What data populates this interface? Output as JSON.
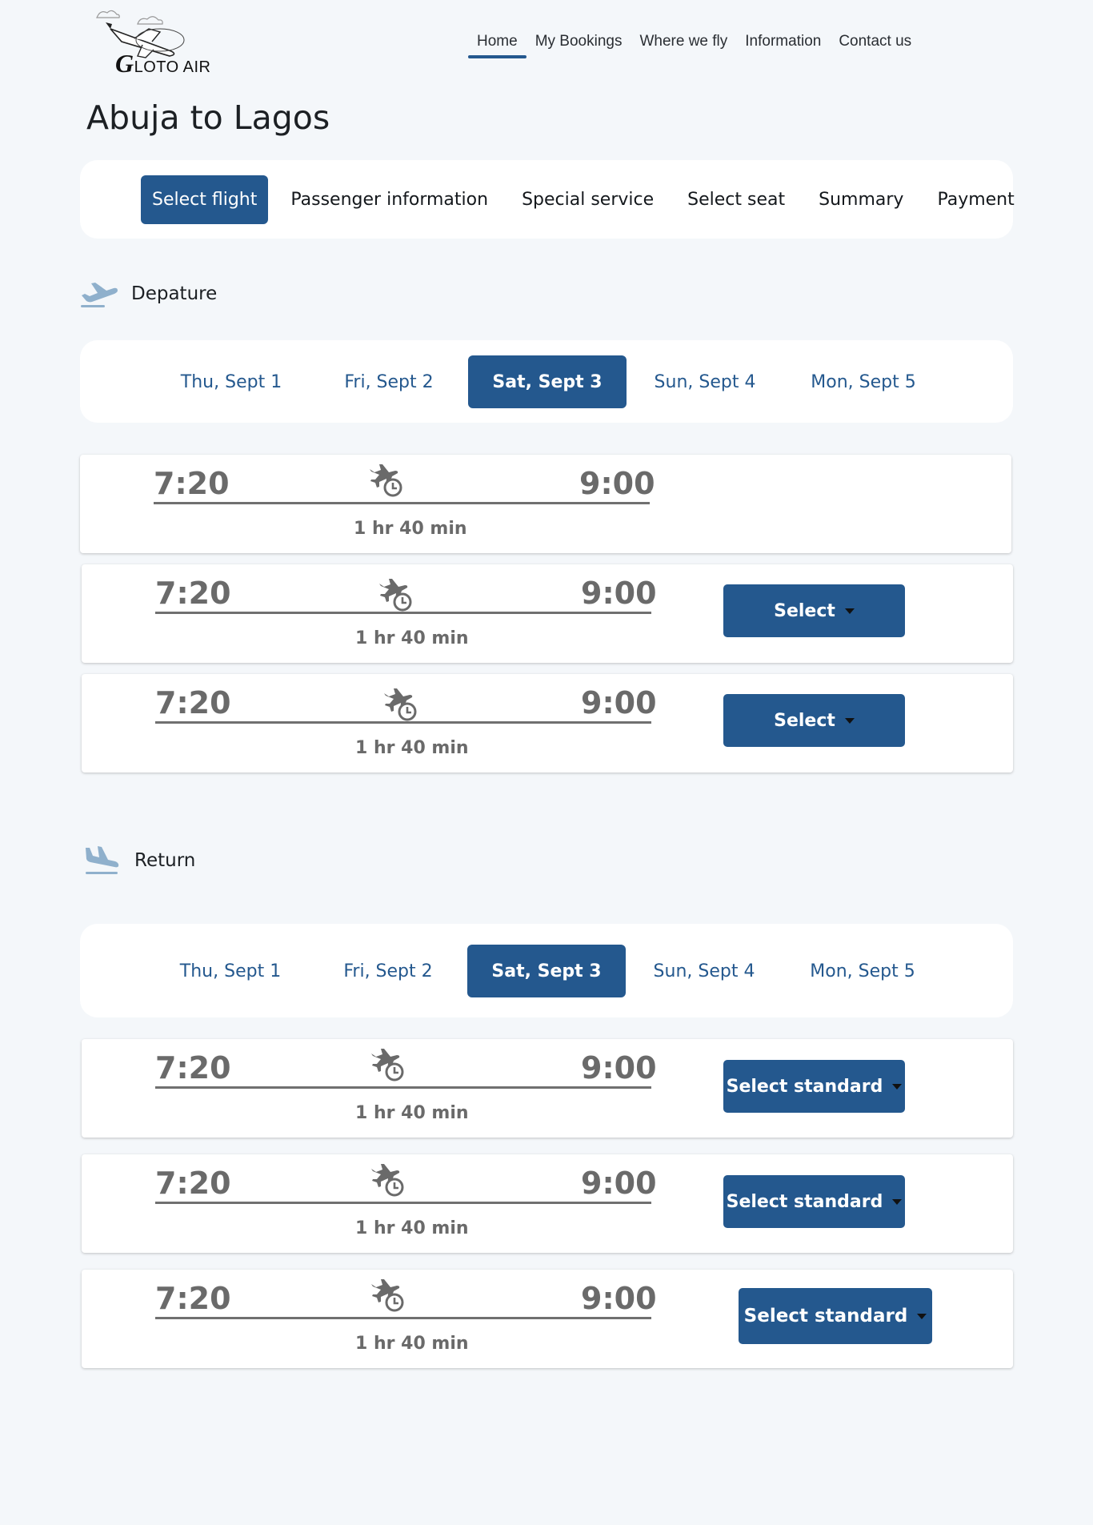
{
  "brand": {
    "logo_g": "G",
    "logo_rest": "LOTO AIR"
  },
  "nav": [
    {
      "label": "Home",
      "active": true
    },
    {
      "label": "My Bookings"
    },
    {
      "label": "Where we fly"
    },
    {
      "label": "Information"
    },
    {
      "label": "Contact us"
    }
  ],
  "page_title": "Abuja to Lagos",
  "steps": [
    {
      "label": "Select flight",
      "active": true
    },
    {
      "label": "Passenger information"
    },
    {
      "label": "Special service"
    },
    {
      "label": "Select seat"
    },
    {
      "label": "Summary"
    },
    {
      "label": "Payment"
    }
  ],
  "departure": {
    "label": "Depature",
    "dates": [
      {
        "label": "Thu, Sept 1"
      },
      {
        "label": "Fri, Sept 2"
      },
      {
        "label": "Sat, Sept 3",
        "active": true
      },
      {
        "label": "Sun, Sept 4"
      },
      {
        "label": "Mon, Sept 5"
      }
    ],
    "flights": [
      {
        "dep": "7:20",
        "arr": "9:00",
        "duration": "1 hr 40 min",
        "button": ""
      },
      {
        "dep": "7:20",
        "arr": "9:00",
        "duration": "1 hr 40 min",
        "button": "Select"
      },
      {
        "dep": "7:20",
        "arr": "9:00",
        "duration": "1 hr 40 min",
        "button": "Select"
      }
    ]
  },
  "return": {
    "label": "Return",
    "dates": [
      {
        "label": "Thu, Sept 1"
      },
      {
        "label": "Fri, Sept 2"
      },
      {
        "label": "Sat, Sept 3",
        "active": true
      },
      {
        "label": "Sun, Sept 4"
      },
      {
        "label": "Mon, Sept 5"
      }
    ],
    "flights": [
      {
        "dep": "7:20",
        "arr": "9:00",
        "duration": "1 hr 40 min",
        "button": "Select standard"
      },
      {
        "dep": "7:20",
        "arr": "9:00",
        "duration": "1 hr 40 min",
        "button": "Select standard"
      },
      {
        "dep": "7:20",
        "arr": "9:00",
        "duration": "1 hr 40 min",
        "button": "Select standard"
      }
    ]
  },
  "icons": {
    "departure_section": "plane-takeoff-icon",
    "return_section": "plane-landing-icon",
    "flight_duration": "plane-clock-icon",
    "button_caret": "caret-down-icon"
  },
  "colors": {
    "primary": "#24588e",
    "background": "#f4f7fa",
    "muted_text": "#6a6a6a",
    "plane_icon": "#8fb0cc"
  }
}
